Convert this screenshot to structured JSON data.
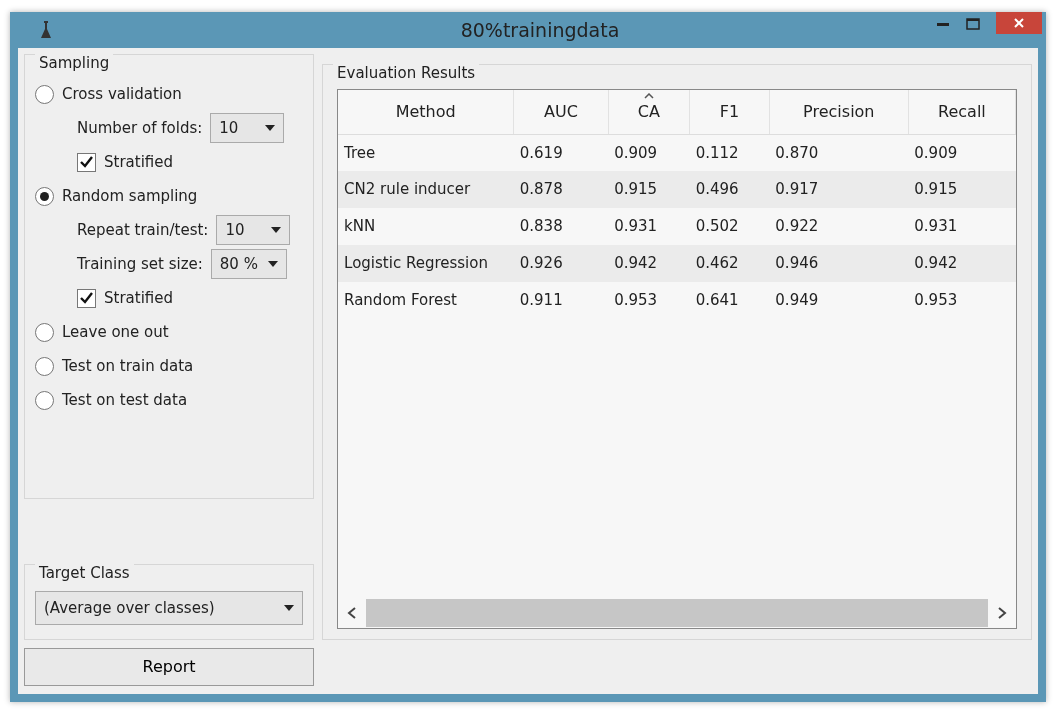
{
  "window": {
    "title": "80%trainingdata"
  },
  "sampling": {
    "title": "Sampling",
    "options": [
      {
        "kind": "radio",
        "label": "Cross validation",
        "selected": false,
        "children": [
          {
            "kind": "dropdown",
            "label": "Number of folds:",
            "value": "10"
          },
          {
            "kind": "checkbox",
            "label": "Stratified",
            "checked": true
          }
        ]
      },
      {
        "kind": "radio",
        "label": "Random sampling",
        "selected": true,
        "children": [
          {
            "kind": "dropdown",
            "label": "Repeat train/test:",
            "value": "10"
          },
          {
            "kind": "dropdown",
            "label": "Training set size:",
            "value": "80 %"
          },
          {
            "kind": "checkbox",
            "label": "Stratified",
            "checked": true
          }
        ]
      },
      {
        "kind": "radio",
        "label": "Leave one out",
        "selected": false
      },
      {
        "kind": "radio",
        "label": "Test on train data",
        "selected": false
      },
      {
        "kind": "radio",
        "label": "Test on test data",
        "selected": false
      }
    ]
  },
  "target_class": {
    "title": "Target Class",
    "value": "(Average over classes)"
  },
  "report_button": "Report",
  "results": {
    "title": "Evaluation Results",
    "columns": [
      {
        "label": "Method",
        "sorted": false
      },
      {
        "label": "AUC",
        "sorted": false
      },
      {
        "label": "CA",
        "sorted": true
      },
      {
        "label": "F1",
        "sorted": false
      },
      {
        "label": "Precision",
        "sorted": false
      },
      {
        "label": "Recall",
        "sorted": false
      }
    ],
    "rows": [
      [
        "Tree",
        "0.619",
        "0.909",
        "0.112",
        "0.870",
        "0.909"
      ],
      [
        "CN2 rule inducer",
        "0.878",
        "0.915",
        "0.496",
        "0.917",
        "0.915"
      ],
      [
        "kNN",
        "0.838",
        "0.931",
        "0.502",
        "0.922",
        "0.931"
      ],
      [
        "Logistic Regression",
        "0.926",
        "0.942",
        "0.462",
        "0.946",
        "0.942"
      ],
      [
        "Random Forest",
        "0.911",
        "0.953",
        "0.641",
        "0.949",
        "0.953"
      ]
    ]
  }
}
